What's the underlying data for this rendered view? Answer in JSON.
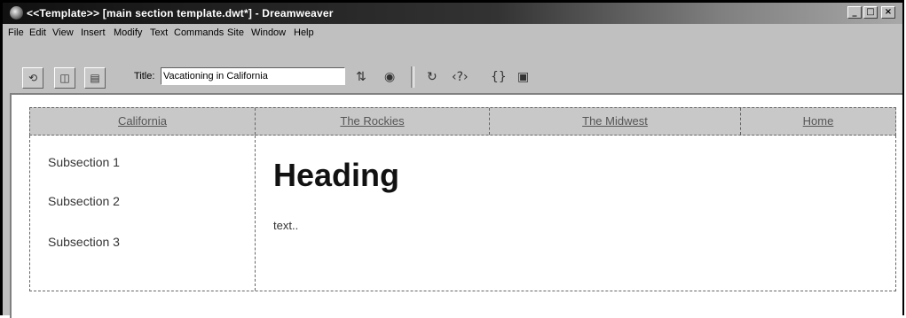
{
  "window": {
    "title": "<<Template>> [main section template.dwt*] - Dreamweaver",
    "buttons": {
      "minimize": "_",
      "maximize": "□",
      "close": "×"
    }
  },
  "menubar": {
    "items": [
      "File",
      "Edit",
      "View",
      "Insert",
      "Modify",
      "Text",
      "Commands",
      "Site",
      "Window",
      "Help"
    ]
  },
  "toolbar": {
    "title_label": "Title:",
    "title_value": "Vacationing in California",
    "icons": [
      "code-view-icon",
      "split-view-icon",
      "design-view-icon",
      "file-management-icon",
      "preview-browser-icon",
      "refresh-icon",
      "reference-icon",
      "code-navigation-icon",
      "view-options-icon"
    ]
  },
  "page": {
    "nav": [
      "California",
      "The Rockies",
      "The Midwest",
      "Home"
    ],
    "subsections": [
      "Subsection 1",
      "Subsection 2",
      "Subsection 3"
    ],
    "heading": "Heading",
    "body_text": "text.."
  }
}
